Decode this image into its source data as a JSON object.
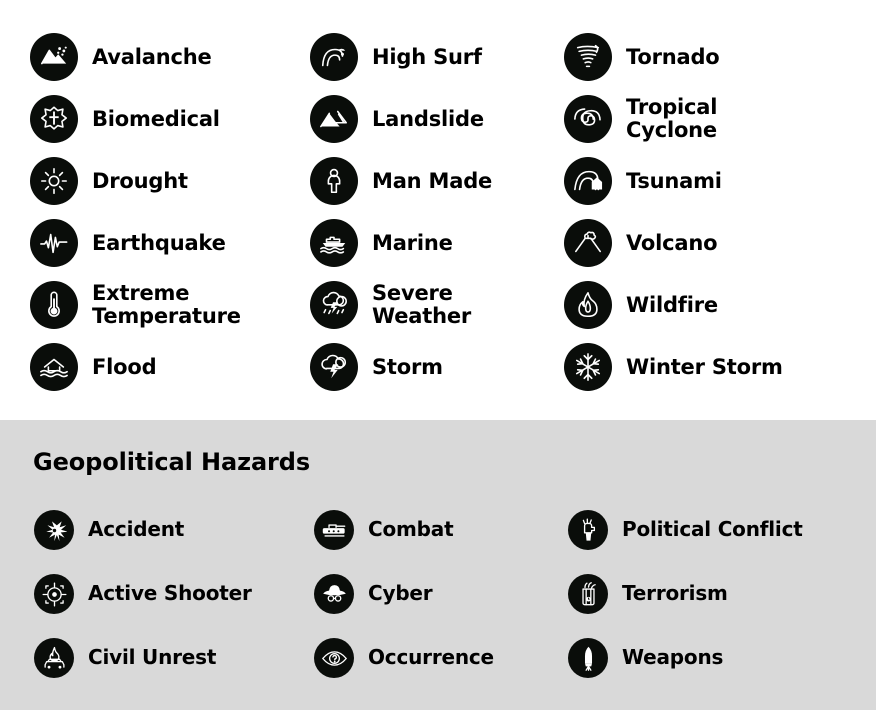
{
  "sections": [
    {
      "id": "natural-hazards",
      "title": "",
      "background": "#ffffff",
      "items": [
        {
          "label": "Avalanche",
          "line2": "",
          "icon": "avalanche-icon",
          "col": 1,
          "row": 1
        },
        {
          "label": "Biomedical",
          "line2": "",
          "icon": "biomedical-star-of-life-icon",
          "col": 1,
          "row": 2
        },
        {
          "label": "Drought",
          "line2": "",
          "icon": "drought-sun-icon",
          "col": 1,
          "row": 3
        },
        {
          "label": "Earthquake",
          "line2": "",
          "icon": "earthquake-seismograph-icon",
          "col": 1,
          "row": 4
        },
        {
          "label": "Extreme",
          "line2": "Temperature",
          "icon": "extreme-temperature-thermometer-icon",
          "col": 1,
          "row": 5
        },
        {
          "label": "Flood",
          "line2": "",
          "icon": "flood-icon",
          "col": 1,
          "row": 6
        },
        {
          "label": "High Surf",
          "line2": "",
          "icon": "high-surf-wave-icon",
          "col": 2,
          "row": 1
        },
        {
          "label": "Landslide",
          "line2": "",
          "icon": "landslide-icon",
          "col": 2,
          "row": 2
        },
        {
          "label": "Man Made",
          "line2": "",
          "icon": "man-made-person-icon",
          "col": 2,
          "row": 3
        },
        {
          "label": "Marine",
          "line2": "",
          "icon": "marine-ship-icon",
          "col": 2,
          "row": 4
        },
        {
          "label": "Severe",
          "line2": "Weather",
          "icon": "severe-weather-cloud-lightning-rain-icon",
          "col": 2,
          "row": 5
        },
        {
          "label": "Storm",
          "line2": "",
          "icon": "storm-cloud-lightning-icon",
          "col": 2,
          "row": 6
        },
        {
          "label": "Tornado",
          "line2": "",
          "icon": "tornado-icon",
          "col": 3,
          "row": 1
        },
        {
          "label": "Tropical",
          "line2": "Cyclone",
          "icon": "tropical-cyclone-spiral-icon",
          "col": 3,
          "row": 2
        },
        {
          "label": "Tsunami",
          "line2": "",
          "icon": "tsunami-wave-icon",
          "col": 3,
          "row": 3
        },
        {
          "label": "Volcano",
          "line2": "",
          "icon": "volcano-icon",
          "col": 3,
          "row": 4
        },
        {
          "label": "Wildfire",
          "line2": "",
          "icon": "wildfire-flame-icon",
          "col": 3,
          "row": 5
        },
        {
          "label": "Winter Storm",
          "line2": "",
          "icon": "winter-storm-snowflake-icon",
          "col": 3,
          "row": 6
        }
      ]
    },
    {
      "id": "geopolitical-hazards",
      "title": "Geopolitical Hazards",
      "background": "#d9d9d9",
      "items": [
        {
          "label": "Accident",
          "line2": "",
          "icon": "accident-starburst-icon",
          "col": 1,
          "row": 1
        },
        {
          "label": "Active Shooter",
          "line2": "",
          "icon": "active-shooter-crosshair-icon",
          "col": 1,
          "row": 2
        },
        {
          "label": "Civil Unrest",
          "line2": "",
          "icon": "civil-unrest-burning-car-icon",
          "col": 1,
          "row": 3
        },
        {
          "label": "Combat",
          "line2": "",
          "icon": "combat-tank-icon",
          "col": 2,
          "row": 1
        },
        {
          "label": "Cyber",
          "line2": "",
          "icon": "cyber-spy-icon",
          "col": 2,
          "row": 2
        },
        {
          "label": "Occurrence",
          "line2": "",
          "icon": "occurrence-eye-question-icon",
          "col": 2,
          "row": 3
        },
        {
          "label": "Political Conflict",
          "line2": "",
          "icon": "political-conflict-fist-icon",
          "col": 3,
          "row": 1
        },
        {
          "label": "Terrorism",
          "line2": "",
          "icon": "terrorism-dynamite-icon",
          "col": 3,
          "row": 2
        },
        {
          "label": "Weapons",
          "line2": "",
          "icon": "weapons-bomb-icon",
          "col": 3,
          "row": 3
        }
      ]
    }
  ],
  "colors": {
    "badge": "#0a0d0a",
    "glyph": "#ffffff",
    "text": "#000000",
    "natural_background": "#ffffff",
    "geo_background": "#d9d9d9"
  }
}
